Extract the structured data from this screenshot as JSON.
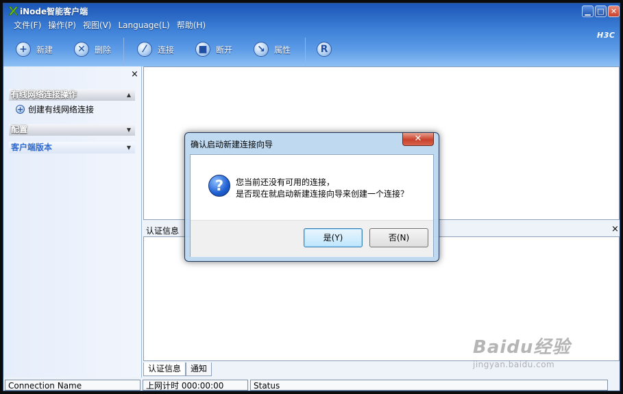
{
  "window": {
    "title": "iNode智能客户端",
    "brand": "H3C",
    "controls": {
      "minimize": "▁",
      "maximize": "□",
      "close": "✕"
    }
  },
  "menu": [
    "文件(F)",
    "操作(P)",
    "视图(V)",
    "Language(L)",
    "帮助(H)"
  ],
  "toolbar": {
    "new": {
      "label": "新建",
      "icon": "plus-icon"
    },
    "delete": {
      "label": "删除",
      "icon": "x-icon"
    },
    "connect": {
      "label": "连接",
      "icon": "connect-icon"
    },
    "disconnect": {
      "label": "断开",
      "icon": "stop-icon"
    },
    "properties": {
      "label": "属性",
      "icon": "wrench-icon"
    },
    "r_glyph": "R"
  },
  "left_panel": {
    "close": "×",
    "sections": [
      {
        "title": "有线网络连接操作",
        "arrow": "▲",
        "items": [
          "创建有线网络连接"
        ]
      },
      {
        "title": "配置",
        "arrow": "▼"
      },
      {
        "title": "客户端版本",
        "arrow": "▼"
      }
    ]
  },
  "auth_panel": {
    "title": "认证信息",
    "close": "×"
  },
  "tabs": [
    "认证信息",
    "通知"
  ],
  "status_bar": {
    "connection_name": "Connection Name",
    "online_time": "上网计时 000:00:00",
    "status": "Status"
  },
  "dialog": {
    "title": "确认启动新建连接向导",
    "close": "✕",
    "icon": "?",
    "message_line1": "您当前还没有可用的连接，",
    "message_line2": "是否现在就启动新建连接向导来创建一个连接？",
    "yes": "是(Y)",
    "no": "否(N)"
  },
  "watermark": {
    "main": "Baidu经验",
    "sub": "jingyan.baidu.com"
  },
  "colors": {
    "title_bar": "#1b55b6",
    "accent": "#2f6ad0",
    "close_button": "#c8412b"
  }
}
